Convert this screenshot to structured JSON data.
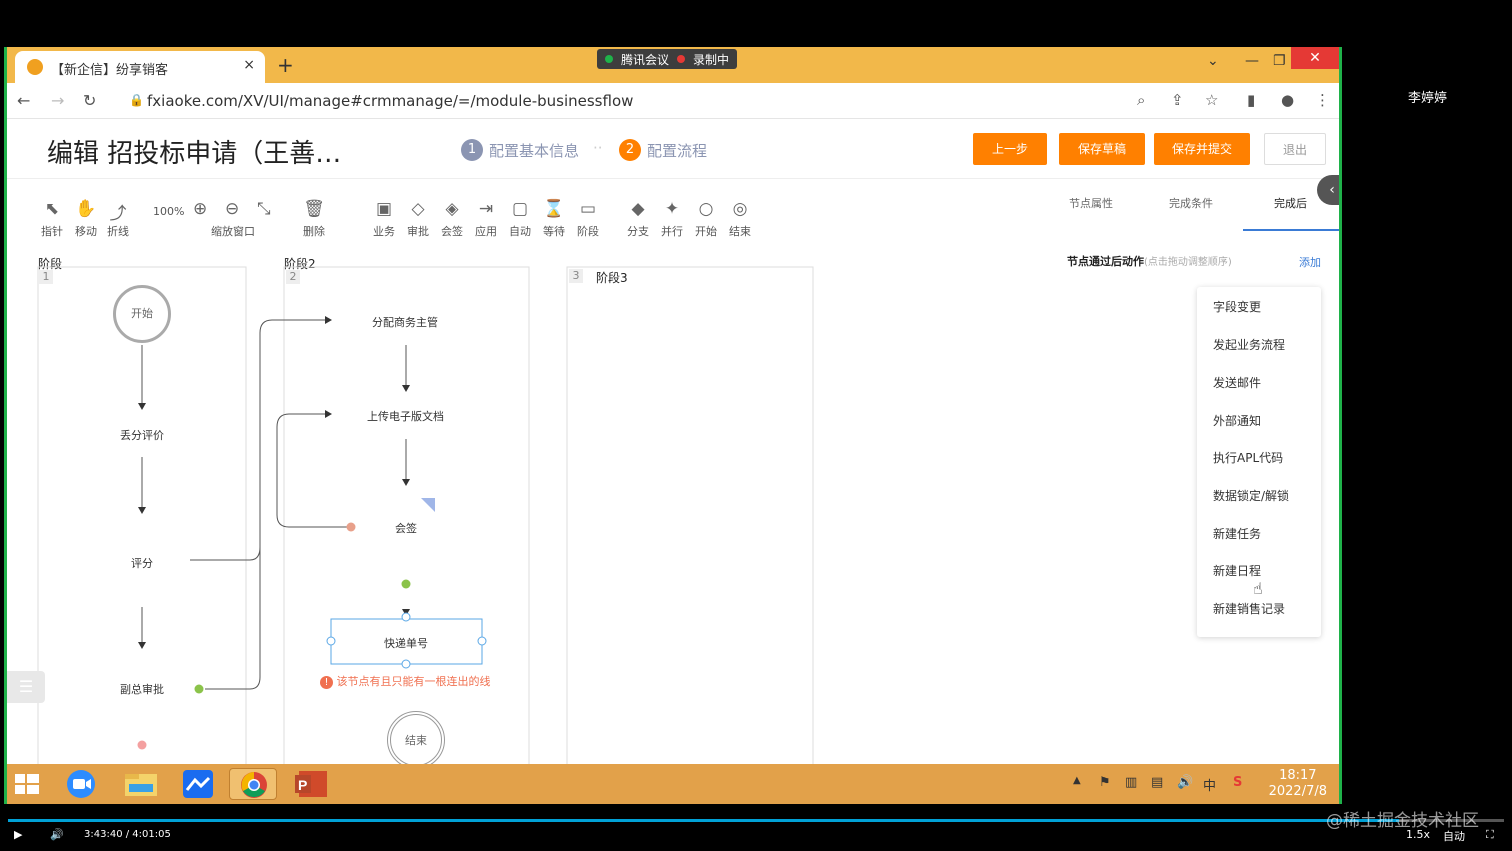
{
  "browser": {
    "tab_title": "【新企信】纷享销客",
    "tab_close": "×",
    "new_tab": "+",
    "url": "fxiaoke.com/XV/UI/manage#crmmanage/=/module-businessflow",
    "meeting_app": "腾讯会议",
    "recording": "录制中"
  },
  "page": {
    "title": "编辑 招投标申请（王善…",
    "steps": [
      {
        "num": "1",
        "label": "配置基本信息"
      },
      {
        "num": "2",
        "label": "配置流程"
      }
    ],
    "step_separator": "··",
    "buttons": {
      "prev": "上一步",
      "save_draft": "保存草稿",
      "save_submit": "保存并提交",
      "exit": "退出"
    }
  },
  "toolbar": {
    "zoom": "100%",
    "items": [
      {
        "label": "指针",
        "icon": "pointer-icon"
      },
      {
        "label": "移动",
        "icon": "hand-icon"
      },
      {
        "label": "折线",
        "icon": "polyline-icon"
      },
      {
        "label": "缩放窗口",
        "icon": "zoom-icon"
      },
      {
        "label": "删除",
        "icon": "trash-icon"
      },
      {
        "label": "业务",
        "icon": "business-icon"
      },
      {
        "label": "审批",
        "icon": "approval-icon"
      },
      {
        "label": "会签",
        "icon": "countersign-icon"
      },
      {
        "label": "应用",
        "icon": "app-icon"
      },
      {
        "label": "自动",
        "icon": "auto-icon"
      },
      {
        "label": "等待",
        "icon": "hourglass-icon"
      },
      {
        "label": "阶段",
        "icon": "stage-icon"
      },
      {
        "label": "分支",
        "icon": "branch-icon"
      },
      {
        "label": "并行",
        "icon": "parallel-icon"
      },
      {
        "label": "开始",
        "icon": "start-icon"
      },
      {
        "label": "结束",
        "icon": "end-icon"
      }
    ]
  },
  "canvas": {
    "stages": [
      {
        "label": "阶段",
        "num": "1"
      },
      {
        "label": "阶段2",
        "num": "2"
      },
      {
        "label": "阶段3",
        "num": "3"
      }
    ],
    "nodes": {
      "start": "开始",
      "score_eval": "丢分评价",
      "score": "评分",
      "vp_approve": "副总审批",
      "assign_manager": "分配商务主管",
      "upload_doc": "上传电子版文档",
      "countersign": "会签",
      "express_no": "快递单号",
      "end": "结束"
    },
    "error_msg": "该节点有且只能有一根连出的线",
    "colors": {
      "node_border": "#5aa7e6",
      "green_dot": "#8bc34a",
      "red_dot": "#e8a08a",
      "error": "#f07050"
    }
  },
  "panel": {
    "tabs": [
      "节点属性",
      "完成条件",
      "完成后"
    ],
    "actions_title": "节点通过后动作",
    "actions_hint": "(点击拖动调整顺序)",
    "add": "添加",
    "dropdown": [
      "字段变更",
      "发起业务流程",
      "发送邮件",
      "外部通知",
      "执行APL代码",
      "数据锁定/解锁",
      "新建任务",
      "新建日程",
      "新建销售记录"
    ]
  },
  "taskbar": {
    "time": "18:17",
    "date": "2022/7/8",
    "ime": "中"
  },
  "video": {
    "user": "李婷婷",
    "time": "3:43:40 / 4:01:05",
    "progress": 0.93,
    "speed": "1.5x",
    "quality": "自动",
    "watermark": "@稀土掘金技术社区"
  }
}
